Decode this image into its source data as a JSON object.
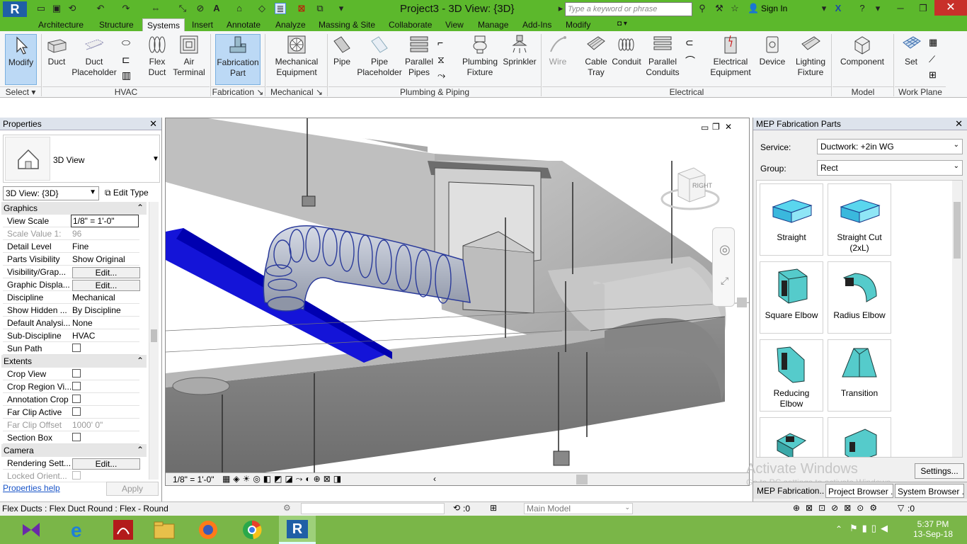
{
  "app": {
    "title": "Project3 - 3D View: {3D}",
    "logo_letter": "R",
    "search_placeholder": "Type a keyword or phrase",
    "sign_in": "Sign In"
  },
  "tabs": [
    "Architecture",
    "Structure",
    "Systems",
    "Insert",
    "Annotate",
    "Analyze",
    "Massing & Site",
    "Collaborate",
    "View",
    "Manage",
    "Add-Ins",
    "Modify"
  ],
  "active_tab": "Systems",
  "ribbon": {
    "buttons": [
      {
        "l1": "Modify",
        "l2": ""
      },
      {
        "l1": "Duct",
        "l2": ""
      },
      {
        "l1": "Duct",
        "l2": "Placeholder"
      },
      {
        "l1": "Flex",
        "l2": "Duct"
      },
      {
        "l1": "Air",
        "l2": "Terminal"
      },
      {
        "l1": "Fabrication",
        "l2": "Part"
      },
      {
        "l1": "Mechanical",
        "l2": "Equipment"
      },
      {
        "l1": "Pipe",
        "l2": ""
      },
      {
        "l1": "Pipe",
        "l2": "Placeholder"
      },
      {
        "l1": "Parallel",
        "l2": "Pipes"
      },
      {
        "l1": "Plumbing",
        "l2": "Fixture"
      },
      {
        "l1": "Sprinkler",
        "l2": ""
      },
      {
        "l1": "Wire",
        "l2": ""
      },
      {
        "l1": "Cable",
        "l2": "Tray"
      },
      {
        "l1": "Conduit",
        "l2": ""
      },
      {
        "l1": "Parallel",
        "l2": "Conduits"
      },
      {
        "l1": "Electrical",
        "l2": "Equipment"
      },
      {
        "l1": "Device",
        "l2": ""
      },
      {
        "l1": "Lighting",
        "l2": "Fixture"
      },
      {
        "l1": "Component",
        "l2": ""
      },
      {
        "l1": "Set",
        "l2": ""
      }
    ],
    "groups": [
      "Select ▾",
      "HVAC",
      "Fabrication ↘",
      "Mechanical ↘",
      "Plumbing & Piping",
      "Electrical",
      "Model",
      "Work Plane"
    ]
  },
  "properties": {
    "title": "Properties",
    "type_name": "3D View",
    "instance_selector": "3D View: {3D}",
    "edit_type": "Edit Type",
    "sections": {
      "graphics": "Graphics",
      "extents": "Extents",
      "camera": "Camera"
    },
    "rows": [
      {
        "k": "View Scale",
        "v": "1/8\" = 1'-0\""
      },
      {
        "k": "Scale Value    1:",
        "v": "96"
      },
      {
        "k": "Detail Level",
        "v": "Fine"
      },
      {
        "k": "Parts Visibility",
        "v": "Show Original"
      },
      {
        "k": "Visibility/Grap...",
        "v": "Edit..."
      },
      {
        "k": "Graphic Displa...",
        "v": "Edit..."
      },
      {
        "k": "Discipline",
        "v": "Mechanical"
      },
      {
        "k": "Show Hidden ...",
        "v": "By Discipline"
      },
      {
        "k": "Default Analysi...",
        "v": "None"
      },
      {
        "k": "Sub-Discipline",
        "v": "HVAC"
      },
      {
        "k": "Sun Path",
        "v": ""
      },
      {
        "k": "Crop View",
        "v": ""
      },
      {
        "k": "Crop Region Vi...",
        "v": ""
      },
      {
        "k": "Annotation Crop",
        "v": ""
      },
      {
        "k": "Far Clip Active",
        "v": ""
      },
      {
        "k": "Far Clip Offset",
        "v": "1000'  0\""
      },
      {
        "k": "Section Box",
        "v": ""
      },
      {
        "k": "Rendering Sett...",
        "v": "Edit..."
      },
      {
        "k": "Locked Orient...",
        "v": ""
      }
    ],
    "help": "Properties help",
    "apply": "Apply"
  },
  "viewport": {
    "scale": "1/8\" = 1'-0\"",
    "viewcube_label": "RIGHT"
  },
  "fabrication": {
    "title": "MEP Fabrication Parts",
    "service_label": "Service:",
    "service_value": "Ductwork: +2in WG",
    "group_label": "Group:",
    "group_value": "Rect",
    "parts": [
      {
        "l1": "Straight",
        "l2": ""
      },
      {
        "l1": "Straight Cut",
        "l2": "(2xL)"
      },
      {
        "l1": "Square Elbow",
        "l2": ""
      },
      {
        "l1": "Radius Elbow",
        "l2": ""
      },
      {
        "l1": "Reducing",
        "l2": "Elbow"
      },
      {
        "l1": "Transition",
        "l2": ""
      }
    ],
    "settings": "Settings...",
    "bottom_tabs": [
      "MEP Fabrication...",
      "Project Browser ...",
      "System Browser ..."
    ],
    "watermark1": "Activate Windows",
    "watermark2": "Go to PC settings to activate Windows."
  },
  "status": {
    "text": "Flex Ducts : Flex Duct Round : Flex - Round",
    "count": ":0",
    "model": "Main Model",
    "filter_count": ":0"
  },
  "taskbar": {
    "time": "5:37 PM",
    "date": "13-Sep-18"
  }
}
